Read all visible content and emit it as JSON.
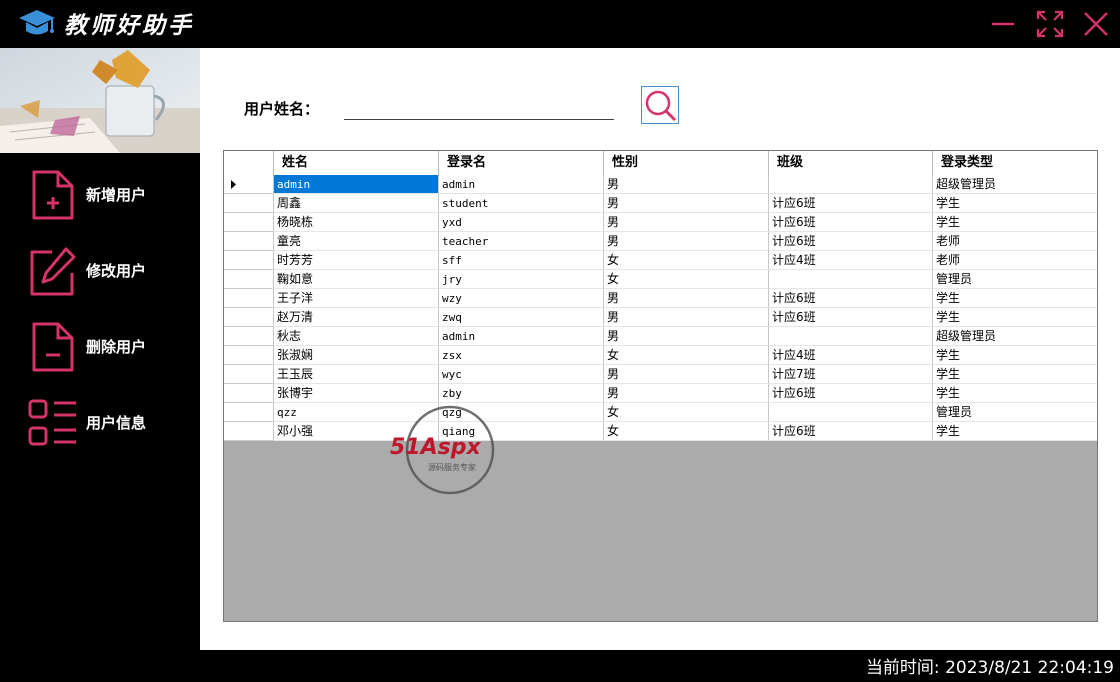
{
  "app": {
    "title": "教师好助手",
    "accent": "#d6336c",
    "logo_icon": "graduation-cap-icon"
  },
  "window_controls": [
    "minimize-icon",
    "maximize-icon",
    "close-icon"
  ],
  "sidebar": {
    "items": [
      {
        "label": "新增用户",
        "icon": "add-file-icon"
      },
      {
        "label": "修改用户",
        "icon": "edit-icon"
      },
      {
        "label": "删除用户",
        "icon": "remove-file-icon"
      },
      {
        "label": "用户信息",
        "icon": "list-icon"
      }
    ]
  },
  "search": {
    "label": "用户姓名：",
    "value": "",
    "placeholder": ""
  },
  "table": {
    "columns": [
      "姓名",
      "登录名",
      "性别",
      "班级",
      "登录类型"
    ],
    "rows": [
      [
        "admin",
        "admin",
        "男",
        "",
        "超级管理员"
      ],
      [
        "周鑫",
        "student",
        "男",
        "计应6班",
        "学生"
      ],
      [
        "杨晓栋",
        "yxd",
        "男",
        "计应6班",
        "学生"
      ],
      [
        "童亮",
        "teacher",
        "男",
        "计应6班",
        "老师"
      ],
      [
        "时芳芳",
        "sff",
        "女",
        "计应4班",
        "老师"
      ],
      [
        "鞠如意",
        "jry",
        "女",
        "",
        "管理员"
      ],
      [
        "王子洋",
        "wzy",
        "男",
        "计应6班",
        "学生"
      ],
      [
        "赵万清",
        "zwq",
        "男",
        "计应6班",
        "学生"
      ],
      [
        "秋志",
        "admin",
        "男",
        "",
        "超级管理员"
      ],
      [
        "张淑娴",
        "zsx",
        "女",
        "计应4班",
        "学生"
      ],
      [
        "王玉辰",
        "wyc",
        "男",
        "计应7班",
        "学生"
      ],
      [
        "张博宇",
        "zby",
        "男",
        "计应6班",
        "学生"
      ],
      [
        "qzz",
        "qzg",
        "女",
        "",
        "管理员"
      ],
      [
        "邓小强",
        "qiang",
        "女",
        "计应6班",
        "学生"
      ]
    ]
  },
  "watermark": {
    "brand": "51Aspx",
    "tagline": "源码服务专家"
  },
  "status": {
    "time_label": "当前时间:",
    "time_value": "2023/8/21 22:04:19"
  }
}
